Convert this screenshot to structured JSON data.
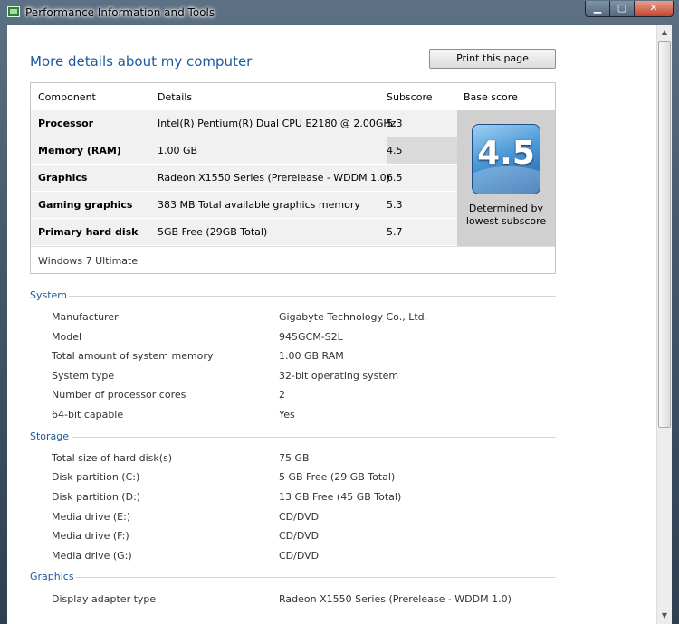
{
  "window": {
    "title": "Performance Information and Tools",
    "controls": {
      "minimize": "▁",
      "maximize": "▢",
      "close": "✕"
    }
  },
  "heading": "More details about my computer",
  "print_button": "Print this page",
  "score_table": {
    "headers": {
      "component": "Component",
      "details": "Details",
      "subscore": "Subscore",
      "base": "Base score"
    },
    "rows": [
      {
        "component": "Processor",
        "details": "Intel(R) Pentium(R) Dual CPU E2180 @ 2.00GHz",
        "subscore": "5.3"
      },
      {
        "component": "Memory (RAM)",
        "details": "1.00 GB",
        "subscore": "4.5"
      },
      {
        "component": "Graphics",
        "details": "Radeon X1550 Series (Prerelease - WDDM 1.0)",
        "subscore": "6.5"
      },
      {
        "component": "Gaming graphics",
        "details": "383 MB Total available graphics memory",
        "subscore": "5.3"
      },
      {
        "component": "Primary hard disk",
        "details": "5GB Free (29GB Total)",
        "subscore": "5.7"
      }
    ],
    "base_score": "4.5",
    "base_caption_line1": "Determined by",
    "base_caption_line2": "lowest subscore",
    "edition": "Windows 7 Ultimate"
  },
  "sections": {
    "system": {
      "title": "System",
      "items": [
        {
          "label": "Manufacturer",
          "value": "Gigabyte Technology Co., Ltd."
        },
        {
          "label": "Model",
          "value": "945GCM-S2L"
        },
        {
          "label": "Total amount of system memory",
          "value": "1.00 GB RAM"
        },
        {
          "label": "System type",
          "value": "32-bit operating system"
        },
        {
          "label": "Number of processor cores",
          "value": "2"
        },
        {
          "label": "64-bit capable",
          "value": "Yes"
        }
      ]
    },
    "storage": {
      "title": "Storage",
      "items": [
        {
          "label": "Total size of hard disk(s)",
          "value": "75 GB"
        },
        {
          "label": "Disk partition (C:)",
          "value": "5 GB Free (29 GB Total)"
        },
        {
          "label": "Disk partition (D:)",
          "value": "13 GB Free (45 GB Total)"
        },
        {
          "label": "Media drive (E:)",
          "value": "CD/DVD"
        },
        {
          "label": "Media drive (F:)",
          "value": "CD/DVD"
        },
        {
          "label": "Media drive (G:)",
          "value": "CD/DVD"
        }
      ]
    },
    "graphics": {
      "title": "Graphics",
      "items": [
        {
          "label": "Display adapter type",
          "value": "Radeon X1550 Series (Prerelease - WDDM 1.0)"
        }
      ]
    }
  },
  "colors": {
    "heading": "#1e5aa0",
    "title_bar": "#44586c",
    "close_button": "#c2452b",
    "badge": "#4a98d6"
  }
}
